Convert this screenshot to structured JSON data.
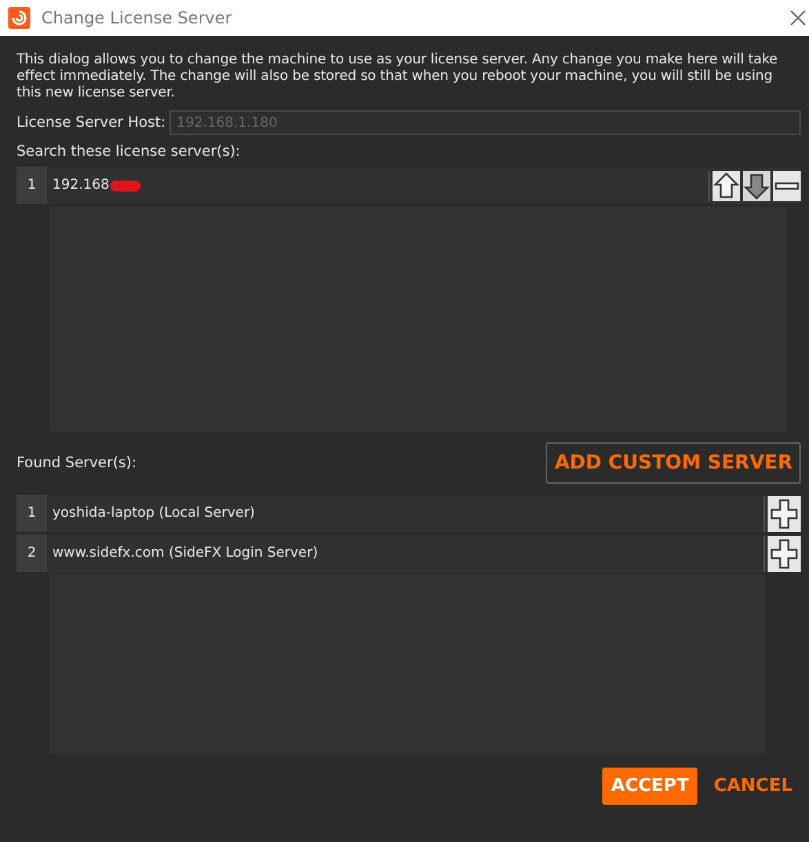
{
  "window": {
    "title": "Change License Server"
  },
  "description": "This dialog allows you to change the machine to use as your license server.  Any change you make here will take effect immediately.  The change will also be stored so that when you reboot your machine, you will still be using this new license server.",
  "host": {
    "label": "License Server Host:",
    "placeholder": "192.168.1.180"
  },
  "search_label": "Search these license server(s):",
  "search_servers": [
    {
      "index": "1",
      "name": "192.168"
    }
  ],
  "found_label": "Found Server(s):",
  "add_custom_button": "ADD CUSTOM SERVER",
  "found_servers": [
    {
      "index": "1",
      "name": "yoshida-laptop (Local Server)"
    },
    {
      "index": "2",
      "name": "www.sidefx.com (SideFX Login Server)"
    }
  ],
  "buttons": [
    {
      "label": "ACCEPT",
      "kind": "primary"
    },
    {
      "label": "CANCEL",
      "kind": "text"
    }
  ]
}
